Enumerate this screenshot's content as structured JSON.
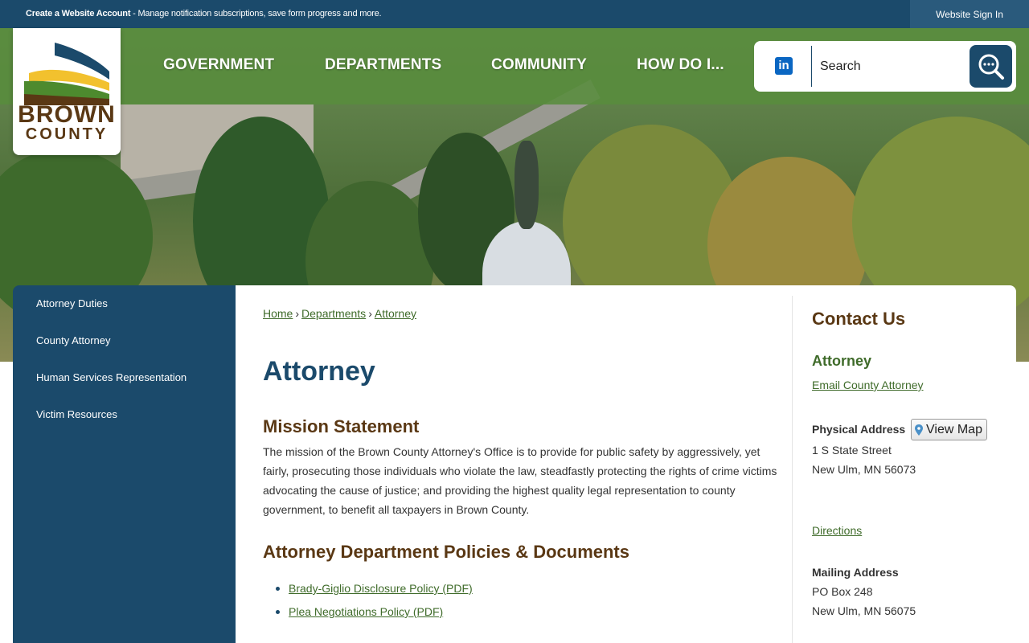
{
  "topbar": {
    "create_account": "Create a Website Account",
    "message": " - Manage notification subscriptions, save form progress and more.",
    "signin": "Website Sign In"
  },
  "logo": {
    "line1": "BROWN",
    "line2": "COUNTY"
  },
  "nav": [
    "GOVERNMENT",
    "DEPARTMENTS",
    "COMMUNITY",
    "HOW DO I..."
  ],
  "search": {
    "placeholder": "Search",
    "social_icon": "linkedin-icon",
    "button_icon": "search-icon"
  },
  "sidebar": {
    "items": [
      {
        "label": "Attorney Duties"
      },
      {
        "label": "County Attorney"
      },
      {
        "label": "Human Services Representation"
      },
      {
        "label": "Victim Resources"
      }
    ]
  },
  "breadcrumb": [
    "Home",
    "Departments",
    "Attorney"
  ],
  "page_title": "Attorney",
  "mission": {
    "heading": "Mission Statement",
    "text": "The mission of the Brown County Attorney's Office is to provide for public safety by aggressively, yet fairly, prosecuting those individuals who violate the law, steadfastly protecting the rights of crime victims advocating the cause of justice; and providing the highest quality legal representation to county government, to benefit all taxpayers in Brown County."
  },
  "policies": {
    "heading": "Attorney Department Policies & Documents",
    "items": [
      "Brady-Giglio Disclosure Policy (PDF)",
      "Plea Negotiations Policy (PDF)"
    ]
  },
  "contact": {
    "title": "Contact Us",
    "dept": "Attorney",
    "email_link": "Email County Attorney",
    "physical_label": "Physical Address",
    "view_map": "View Map",
    "physical_line1": "1 S State Street",
    "physical_line2": "New Ulm, MN 56073",
    "directions": "Directions",
    "mailing_label": "Mailing Address",
    "mailing_line1": "PO Box 248",
    "mailing_line2": "New Ulm, MN 56075"
  },
  "colors": {
    "navy": "#1b4a6b",
    "green": "#3f6b2a",
    "brown": "#5a3814",
    "gold": "#f2c12e"
  }
}
